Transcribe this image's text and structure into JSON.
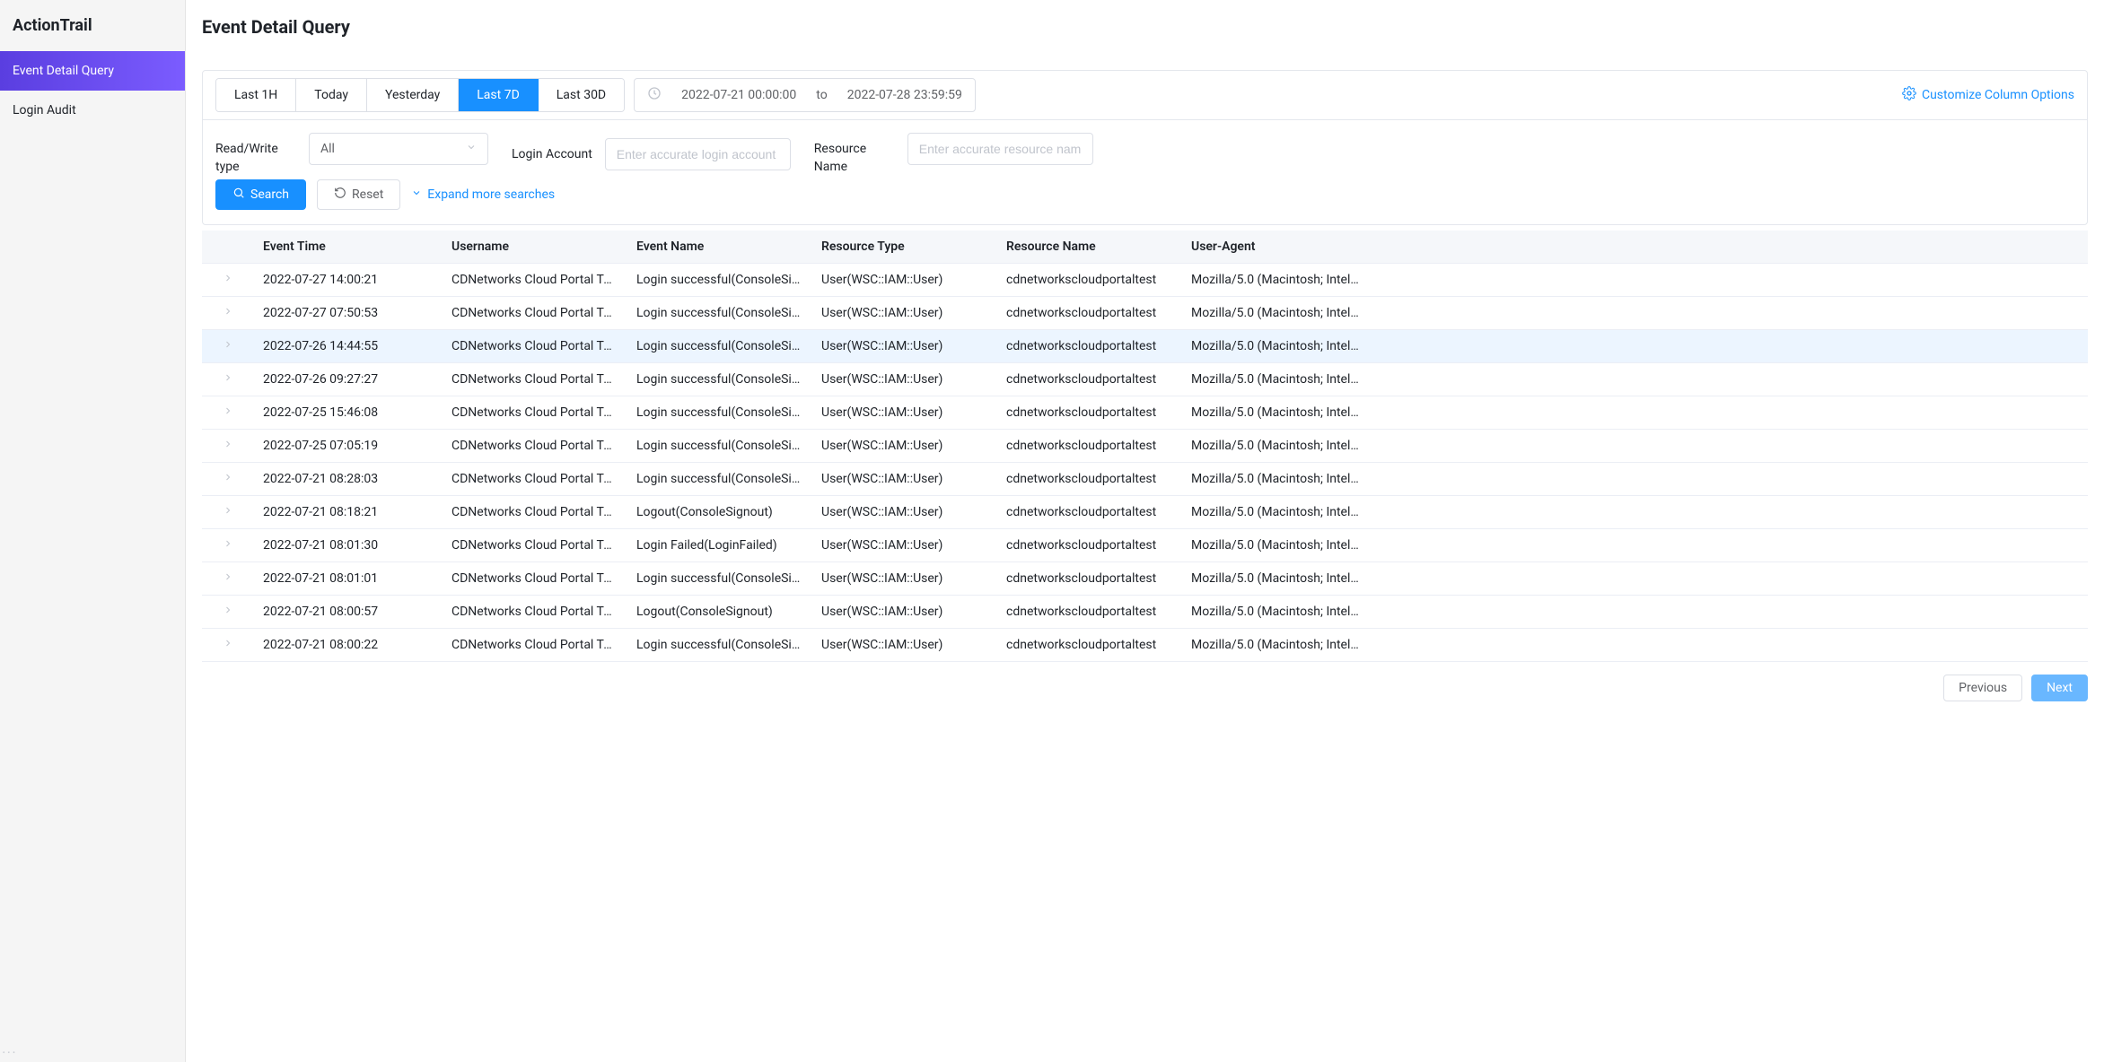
{
  "sidebar": {
    "title": "ActionTrail",
    "items": [
      {
        "label": "Event Detail Query",
        "active": true
      },
      {
        "label": "Login Audit",
        "active": false
      }
    ]
  },
  "page": {
    "title": "Event Detail Query"
  },
  "query": {
    "range_tabs": [
      "Last 1H",
      "Today",
      "Yesterday",
      "Last 7D",
      "Last 30D"
    ],
    "range_selected": "Last 7D",
    "date_from": "2022-07-21 00:00:00",
    "date_sep": "to",
    "date_to": "2022-07-28 23:59:59",
    "customize_label": "Customize Column Options",
    "fields": {
      "read_write": {
        "label": "Read/Write type",
        "value": "All"
      },
      "login_account": {
        "label": "Login Account",
        "placeholder": "Enter accurate login account",
        "value": ""
      },
      "resource_name": {
        "label": "Resource Name",
        "placeholder": "Enter accurate resource name",
        "value": ""
      }
    },
    "buttons": {
      "search": "Search",
      "reset": "Reset",
      "expand": "Expand more searches"
    }
  },
  "table": {
    "columns": [
      "Event Time",
      "Username",
      "Event Name",
      "Resource Type",
      "Resource Name",
      "User-Agent"
    ],
    "rows": [
      {
        "time": "2022-07-27 14:00:21",
        "username": "CDNetworks Cloud Portal Tes…",
        "event": "Login successful(ConsoleSig…",
        "rtype": "User(WSC::IAM::User)",
        "rname": "cdnetworkscloudportaltest",
        "agent": "Mozilla/5.0 (Macintosh; Intel…",
        "hovered": false
      },
      {
        "time": "2022-07-27 07:50:53",
        "username": "CDNetworks Cloud Portal Tes…",
        "event": "Login successful(ConsoleSig…",
        "rtype": "User(WSC::IAM::User)",
        "rname": "cdnetworkscloudportaltest",
        "agent": "Mozilla/5.0 (Macintosh; Intel…",
        "hovered": false
      },
      {
        "time": "2022-07-26 14:44:55",
        "username": "CDNetworks Cloud Portal Tes…",
        "event": "Login successful(ConsoleSig…",
        "rtype": "User(WSC::IAM::User)",
        "rname": "cdnetworkscloudportaltest",
        "agent": "Mozilla/5.0 (Macintosh; Intel…",
        "hovered": true
      },
      {
        "time": "2022-07-26 09:27:27",
        "username": "CDNetworks Cloud Portal Tes…",
        "event": "Login successful(ConsoleSig…",
        "rtype": "User(WSC::IAM::User)",
        "rname": "cdnetworkscloudportaltest",
        "agent": "Mozilla/5.0 (Macintosh; Intel…",
        "hovered": false
      },
      {
        "time": "2022-07-25 15:46:08",
        "username": "CDNetworks Cloud Portal Tes…",
        "event": "Login successful(ConsoleSig…",
        "rtype": "User(WSC::IAM::User)",
        "rname": "cdnetworkscloudportaltest",
        "agent": "Mozilla/5.0 (Macintosh; Intel…",
        "hovered": false
      },
      {
        "time": "2022-07-25 07:05:19",
        "username": "CDNetworks Cloud Portal Tes…",
        "event": "Login successful(ConsoleSig…",
        "rtype": "User(WSC::IAM::User)",
        "rname": "cdnetworkscloudportaltest",
        "agent": "Mozilla/5.0 (Macintosh; Intel…",
        "hovered": false
      },
      {
        "time": "2022-07-21 08:28:03",
        "username": "CDNetworks Cloud Portal Tes…",
        "event": "Login successful(ConsoleSig…",
        "rtype": "User(WSC::IAM::User)",
        "rname": "cdnetworkscloudportaltest",
        "agent": "Mozilla/5.0 (Macintosh; Intel…",
        "hovered": false
      },
      {
        "time": "2022-07-21 08:18:21",
        "username": "CDNetworks Cloud Portal Tes…",
        "event": "Logout(ConsoleSignout)",
        "rtype": "User(WSC::IAM::User)",
        "rname": "cdnetworkscloudportaltest",
        "agent": "Mozilla/5.0 (Macintosh; Intel…",
        "hovered": false
      },
      {
        "time": "2022-07-21 08:01:30",
        "username": "CDNetworks Cloud Portal Tes…",
        "event": "Login Failed(LoginFailed)",
        "rtype": "User(WSC::IAM::User)",
        "rname": "cdnetworkscloudportaltest",
        "agent": "Mozilla/5.0 (Macintosh; Intel…",
        "hovered": false
      },
      {
        "time": "2022-07-21 08:01:01",
        "username": "CDNetworks Cloud Portal Tes…",
        "event": "Login successful(ConsoleSig…",
        "rtype": "User(WSC::IAM::User)",
        "rname": "cdnetworkscloudportaltest",
        "agent": "Mozilla/5.0 (Macintosh; Intel…",
        "hovered": false
      },
      {
        "time": "2022-07-21 08:00:57",
        "username": "CDNetworks Cloud Portal Tes…",
        "event": "Logout(ConsoleSignout)",
        "rtype": "User(WSC::IAM::User)",
        "rname": "cdnetworkscloudportaltest",
        "agent": "Mozilla/5.0 (Macintosh; Intel…",
        "hovered": false
      },
      {
        "time": "2022-07-21 08:00:22",
        "username": "CDNetworks Cloud Portal Tes…",
        "event": "Login successful(ConsoleSig…",
        "rtype": "User(WSC::IAM::User)",
        "rname": "cdnetworkscloudportaltest",
        "agent": "Mozilla/5.0 (Macintosh; Intel…",
        "hovered": false
      }
    ]
  },
  "pagination": {
    "previous": "Previous",
    "next": "Next"
  }
}
